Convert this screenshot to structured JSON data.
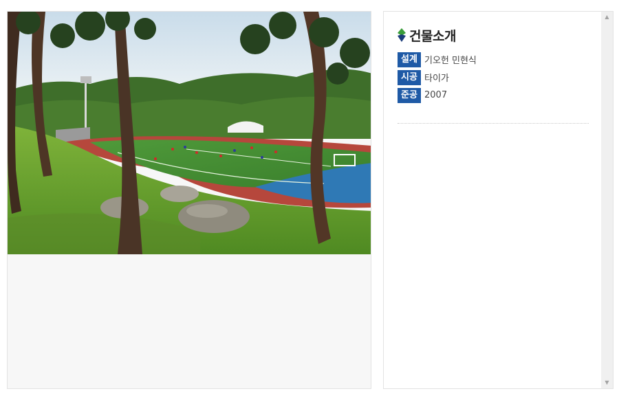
{
  "gallery": {
    "image_alt": "Photo of a sports field surrounded by pine trees and green hills"
  },
  "info": {
    "title": "건물소개",
    "specs": [
      {
        "key": "설계",
        "value": "기오헌 민현식"
      },
      {
        "key": "시공",
        "value": "타이가"
      },
      {
        "key": "준공",
        "value": "2007"
      }
    ]
  },
  "scrollbar": {
    "up_icon": "▲",
    "down_icon": "▼"
  },
  "colors": {
    "accent_blue": "#1f5aa6",
    "icon_green": "#3a9d3a",
    "icon_navy": "#1b3c7a"
  }
}
